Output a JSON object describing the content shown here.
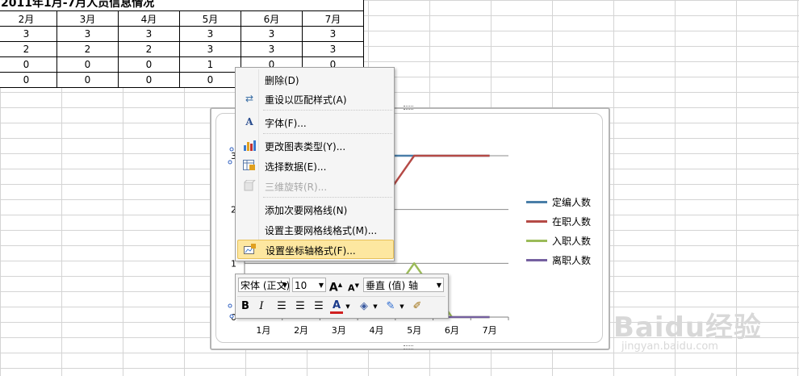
{
  "sheet": {
    "title": "2011年1月-7月人员信息情况",
    "months": [
      "2月",
      "3月",
      "4月",
      "5月",
      "6月",
      "7月"
    ],
    "rows": [
      [
        "3",
        "3",
        "3",
        "3",
        "3",
        "3"
      ],
      [
        "2",
        "2",
        "2",
        "3",
        "3",
        "3"
      ],
      [
        "0",
        "0",
        "0",
        "1",
        "0",
        "0"
      ],
      [
        "0",
        "0",
        "0",
        "0",
        "",
        ""
      ]
    ]
  },
  "context_menu": {
    "items": [
      {
        "label": "删除(D)",
        "icon": "",
        "enabled": true
      },
      {
        "label": "重设以匹配样式(A)",
        "icon": "reset-style-icon",
        "enabled": true
      },
      {
        "label": "字体(F)...",
        "icon": "font-icon",
        "enabled": true
      },
      {
        "label": "更改图表类型(Y)...",
        "icon": "chart-type-icon",
        "enabled": true
      },
      {
        "label": "选择数据(E)...",
        "icon": "select-data-icon",
        "enabled": true
      },
      {
        "label": "三维旋转(R)...",
        "icon": "rotate-3d-icon",
        "enabled": false
      },
      {
        "label": "添加次要网格线(N)",
        "icon": "",
        "enabled": true
      },
      {
        "label": "设置主要网格线格式(M)...",
        "icon": "",
        "enabled": true
      },
      {
        "label": "设置坐标轴格式(F)...",
        "icon": "axis-format-icon",
        "enabled": true,
        "highlighted": true
      }
    ]
  },
  "mini_toolbar": {
    "font_name": "宋体 (正文)",
    "font_size": "10",
    "grow_font": "A",
    "shrink_font": "A",
    "axis_select": "垂直 (值) 轴",
    "bold": "B",
    "italic": "I",
    "font_color_letter": "A"
  },
  "chart_data": {
    "type": "line",
    "categories": [
      "1月",
      "2月",
      "3月",
      "4月",
      "5月",
      "6月",
      "7月"
    ],
    "ylim": [
      0,
      3
    ],
    "yticks": [
      "0",
      "1",
      "2",
      "3"
    ],
    "series": [
      {
        "name": "定编人数",
        "color": "#4a7ea8",
        "values": [
          3,
          3,
          3,
          3,
          3,
          3,
          3
        ]
      },
      {
        "name": "在职人数",
        "color": "#b54a46",
        "values": [
          2,
          2,
          2,
          2,
          3,
          3,
          3
        ]
      },
      {
        "name": "入职人数",
        "color": "#9bbb59",
        "values": [
          0,
          0,
          0,
          0,
          1,
          0,
          0
        ]
      },
      {
        "name": "离职人数",
        "color": "#7560a0",
        "values": [
          0,
          0,
          0,
          0,
          0,
          0,
          0
        ]
      }
    ]
  },
  "watermark": {
    "brand": "Baidu经验",
    "url": "jingyan.baidu.com"
  }
}
